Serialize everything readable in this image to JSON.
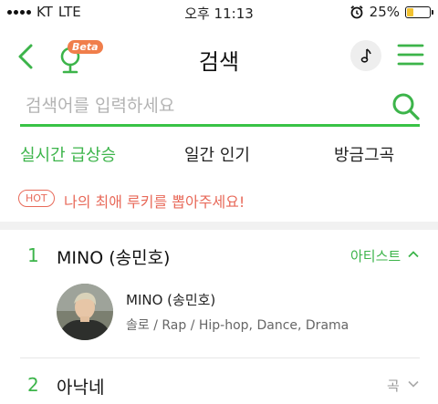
{
  "status_bar": {
    "carrier": "KT",
    "network": "LTE",
    "time": "오후 11:13",
    "battery_percent_label": "25%",
    "battery_level": 0.25
  },
  "header": {
    "beta_label": "Beta",
    "title": "검색",
    "icons": [
      "back-icon",
      "microphone-icon",
      "music-note-icon",
      "menu-icon"
    ]
  },
  "search": {
    "placeholder": "검색어를 입력하세요",
    "value": ""
  },
  "tabs": [
    {
      "label": "실시간 급상승",
      "active": true
    },
    {
      "label": "일간 인기",
      "active": false
    },
    {
      "label": "방금그곡",
      "active": false
    }
  ],
  "hot_banner": {
    "badge": "HOT",
    "text": "나의 최애 루키를 뽑아주세요!"
  },
  "results": [
    {
      "rank": "1",
      "title": "MINO (송민호)",
      "category": "아티스트",
      "expanded": true,
      "detail": {
        "name": "MINO (송민호)",
        "meta": "솔로 / Rap / Hip-hop, Dance, Drama"
      }
    },
    {
      "rank": "2",
      "title": "아낙네",
      "category": "곡",
      "expanded": false
    }
  ],
  "colors": {
    "accent_green": "#3cb44a",
    "hot_red": "#e86a5a",
    "beta_orange": "#f07e4b"
  }
}
